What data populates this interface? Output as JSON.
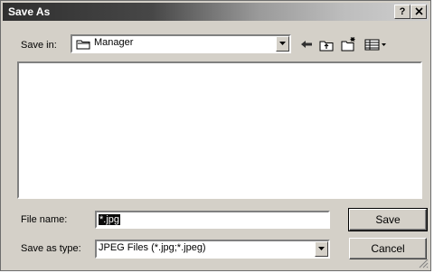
{
  "window": {
    "title": "Save As",
    "help_label": "?",
    "close_label": "X"
  },
  "save_in": {
    "label": "Save in:",
    "value": "Manager",
    "icon": "folder-icon"
  },
  "toolbar": {
    "back_icon": "back-arrow-icon",
    "up_icon": "up-folder-icon",
    "new_folder_icon": "new-folder-icon",
    "view_menu_icon": "view-menu-icon"
  },
  "file_name": {
    "label": "File name:",
    "value": "*.jpg"
  },
  "save_as_type": {
    "label": "Save as type:",
    "value": "JPEG Files (*.jpg;*.jpeg)"
  },
  "buttons": {
    "save": "Save",
    "cancel": "Cancel"
  },
  "colors": {
    "dialog_face": "#d4d0c8",
    "selection": "#0a0a0a"
  }
}
